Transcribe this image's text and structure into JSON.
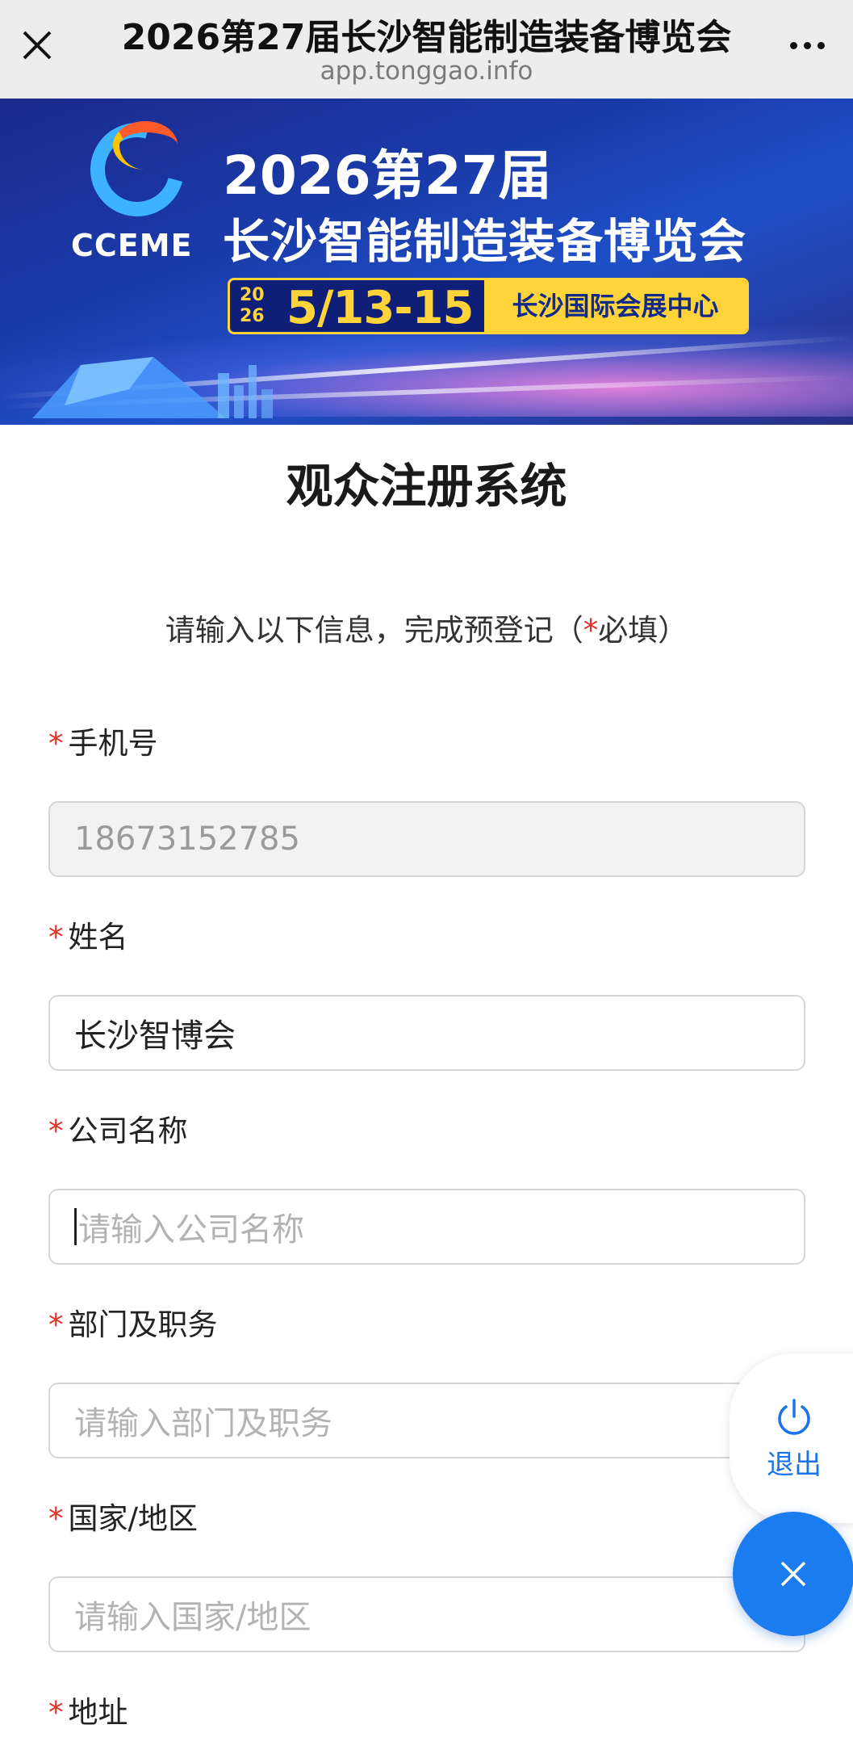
{
  "topbar": {
    "title": "2026第27届长沙智能制造装备博览会",
    "url": "app.tonggao.info"
  },
  "banner": {
    "logo_text": "CCEME",
    "line1": "2026第27届",
    "line2": "长沙智能制造装备博览会",
    "year_top": "20",
    "year_bottom": "26",
    "dates": "5/13-15",
    "venue": "长沙国际会展中心"
  },
  "page": {
    "title": "观众注册系统",
    "hint_before": "请输入以下信息，完成预登记（",
    "hint_star": "*",
    "hint_after": "必填）"
  },
  "form": {
    "required_mark": "*",
    "phone": {
      "label": "手机号",
      "value": "18673152785"
    },
    "name": {
      "label": "姓名",
      "value": "长沙智博会"
    },
    "company": {
      "label": "公司名称",
      "placeholder": "请输入公司名称"
    },
    "dept": {
      "label": "部门及职务",
      "placeholder": "请输入部门及职务"
    },
    "country": {
      "label": "国家/地区",
      "placeholder": "请输入国家/地区"
    },
    "address": {
      "label": "地址"
    }
  },
  "floating": {
    "exit_label": "退出",
    "exit_icon": "power-icon",
    "close_icon": "close-icon"
  },
  "colors": {
    "accent": "#1b7cf0",
    "required": "#e0302a",
    "banner_yellow": "#ffd43a"
  }
}
